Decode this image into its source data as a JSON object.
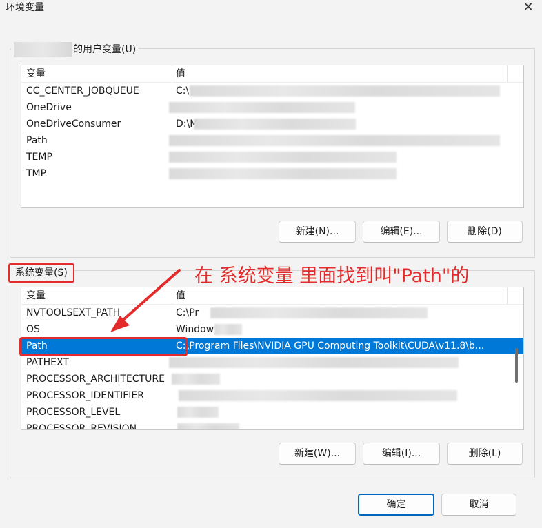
{
  "window": {
    "title": "环境变量",
    "close_glyph": "✕"
  },
  "user_section": {
    "legend": "的用户变量(U)",
    "columns": {
      "name": "变量",
      "value": "值"
    },
    "rows": [
      {
        "name": "CC_CENTER_JOBQUEUE",
        "value": "C:\\"
      },
      {
        "name": "OneDrive",
        "value": ""
      },
      {
        "name": "OneDriveConsumer",
        "value": "D:\\M"
      },
      {
        "name": "Path",
        "value": ""
      },
      {
        "name": "TEMP",
        "value": ""
      },
      {
        "name": "TMP",
        "value": ""
      }
    ],
    "buttons": {
      "new": "新建(N)...",
      "edit": "编辑(E)...",
      "delete": "删除(D)"
    }
  },
  "system_section": {
    "legend": "系统变量(S)",
    "columns": {
      "name": "变量",
      "value": "值"
    },
    "rows": [
      {
        "name": "NVTOOLSEXT_PATH",
        "value": "C:\\Pr"
      },
      {
        "name": "OS",
        "value": "Window"
      },
      {
        "name": "Path",
        "value": "C:\\Program Files\\NVIDIA GPU Computing Toolkit\\CUDA\\v11.8\\b...",
        "selected": true
      },
      {
        "name": "PATHEXT",
        "value": ""
      },
      {
        "name": "PROCESSOR_ARCHITECTURE",
        "value": ""
      },
      {
        "name": "PROCESSOR_IDENTIFIER",
        "value": ""
      },
      {
        "name": "PROCESSOR_LEVEL",
        "value": ""
      },
      {
        "name": "PROCESSOR_REVISION",
        "value": ""
      }
    ],
    "buttons": {
      "new": "新建(W)...",
      "edit": "编辑(I)...",
      "delete": "删除(L)"
    }
  },
  "footer": {
    "ok": "确定",
    "cancel": "取消"
  },
  "annotation": {
    "text": "在 系统变量 里面找到叫\"Path\"的",
    "color": "#e32b2b"
  },
  "colors": {
    "selection": "#0078d7",
    "annotation": "#e32b2b",
    "primary_border": "#0067c0"
  }
}
